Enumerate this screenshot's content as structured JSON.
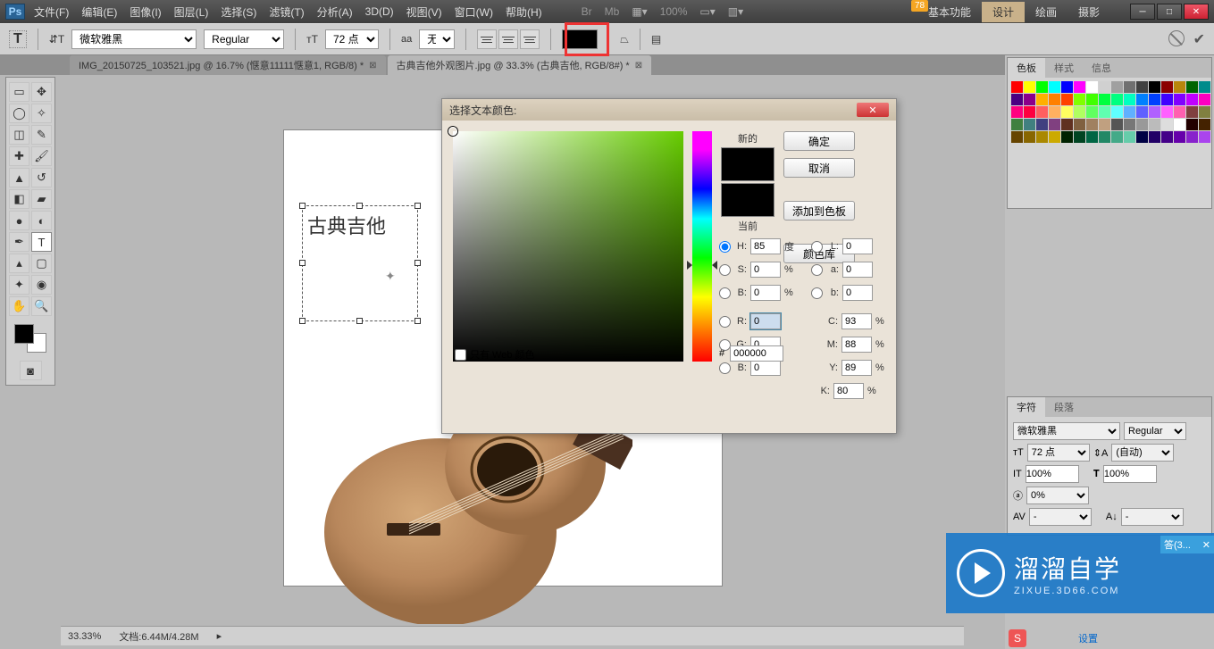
{
  "badge": "78",
  "menu": {
    "items": [
      "文件(F)",
      "编辑(E)",
      "图像(I)",
      "图层(L)",
      "选择(S)",
      "滤镜(T)",
      "分析(A)",
      "3D(D)",
      "视图(V)",
      "窗口(W)",
      "帮助(H)"
    ],
    "zoom": "100%",
    "modes": {
      "m0": "基本功能",
      "m1": "设计",
      "m2": "绘画",
      "m3": "摄影"
    }
  },
  "optbar": {
    "font": "微软雅黑",
    "weight": "Regular",
    "size": "72 点",
    "aa_prefix": "aa",
    "aa": "无"
  },
  "tabs": {
    "t0": "IMG_20150725_103521.jpg @ 16.7% (惬意11111惬意1, RGB/8) *",
    "t1": "古典吉他外观图片.jpg @ 33.3% (古典吉他, RGB/8#) *"
  },
  "canvas": {
    "text": "古典吉他"
  },
  "dialog": {
    "title": "选择文本颜色:",
    "new": "新的",
    "current": "当前",
    "ok": "确定",
    "cancel": "取消",
    "addswatch": "添加到色板",
    "colorlib": "颜色库",
    "H": "85",
    "S": "0",
    "B": "0",
    "L": "0",
    "a": "0",
    "b_lab": "0",
    "R": "0",
    "G": "0",
    "Bc": "0",
    "C": "93",
    "M": "88",
    "Y": "89",
    "K": "80",
    "deg": "度",
    "pct": "%",
    "hex": "000000",
    "webonly": "只有 Web 颜色"
  },
  "rightpanels": {
    "swatch_tabs": {
      "t0": "色板",
      "t1": "样式",
      "t2": "信息"
    },
    "char_tabs": {
      "t0": "字符",
      "t1": "段落"
    },
    "char": {
      "font": "微软雅黑",
      "weight": "Regular",
      "size": "72 点",
      "leading": "(自动)",
      "track": "100%",
      "track2": "100%",
      "baseline": "0%"
    }
  },
  "status": {
    "zoom": "33.33%",
    "doc": "文档:6.44M/4.28M"
  },
  "watermark": {
    "brand": "溜溜自学",
    "url": "ZIXUE.3D66.COM"
  },
  "notif": "答(3...",
  "settings": "设置",
  "swatch_colors": [
    "#ff0000",
    "#ffff00",
    "#00ff00",
    "#00ffff",
    "#0000ff",
    "#ff00ff",
    "#ffffff",
    "#d0d0d0",
    "#a0a0a0",
    "#707070",
    "#404040",
    "#000000",
    "#8b0000",
    "#b8860b",
    "#006400",
    "#008b8b",
    "#4b0082",
    "#8b008b",
    "#ffb000",
    "#ff8000",
    "#ff4000",
    "#80ff00",
    "#40ff00",
    "#00ff40",
    "#00ff80",
    "#00ffc0",
    "#0080ff",
    "#0040ff",
    "#4000ff",
    "#8000ff",
    "#c000ff",
    "#ff00c0",
    "#ff0080",
    "#ff0040",
    "#ff6060",
    "#ffb060",
    "#ffff60",
    "#b0ff60",
    "#60ff60",
    "#60ffb0",
    "#60ffff",
    "#60b0ff",
    "#6060ff",
    "#b060ff",
    "#ff60ff",
    "#ff60b0",
    "#804040",
    "#808040",
    "#408040",
    "#408080",
    "#404080",
    "#804080",
    "#603020",
    "#806040",
    "#a08060",
    "#c0a080",
    "#555",
    "#777",
    "#999",
    "#bbb",
    "#ddd",
    "#fff",
    "#220000",
    "#442200",
    "#664400",
    "#886600",
    "#aa8800",
    "#ccaa00",
    "#002200",
    "#004422",
    "#006644",
    "#228866",
    "#44aa88",
    "#66ccaa",
    "#000044",
    "#220066",
    "#440088",
    "#6600aa",
    "#8822cc",
    "#aa44ee"
  ]
}
